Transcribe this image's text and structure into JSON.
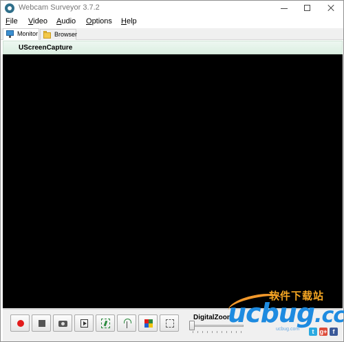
{
  "window": {
    "title": "Webcam Surveyor 3.7.2"
  },
  "menu": {
    "file": {
      "accel": "F",
      "rest": "ile"
    },
    "video": {
      "accel": "V",
      "rest": "ideo"
    },
    "audio": {
      "accel": "A",
      "rest": "udio"
    },
    "options": {
      "accel": "O",
      "rest": "ptions"
    },
    "help": {
      "accel": "H",
      "rest": "elp"
    }
  },
  "tabs": [
    {
      "label": "Monitor",
      "icon": "monitor-icon",
      "active": true
    },
    {
      "label": "Browser",
      "icon": "folder-icon",
      "active": false
    }
  ],
  "capture": {
    "title": "UScreenCapture",
    "background": "#000000"
  },
  "toolbar": {
    "buttons": [
      {
        "name": "record",
        "icon": "record-icon"
      },
      {
        "name": "stop",
        "icon": "stop-icon"
      },
      {
        "name": "snapshot",
        "icon": "camera-icon"
      },
      {
        "name": "playback",
        "icon": "play-icon"
      },
      {
        "name": "motion-detection",
        "icon": "motion-icon"
      },
      {
        "name": "broadcast",
        "icon": "broadcast-icon"
      },
      {
        "name": "color-settings",
        "icon": "color-icon"
      },
      {
        "name": "full-screen",
        "icon": "fullscreen-icon"
      }
    ],
    "zoom_label": "DigitalZoom",
    "zoom_level": 0
  },
  "watermark": {
    "top_text": "软件下载站",
    "logo_main": "ucbug",
    "logo_suffix": ".cc",
    "url": "ucbug.com",
    "social": [
      "t",
      "g+",
      "f"
    ]
  },
  "colors": {
    "accent": "#1e8be0",
    "record": "#e21b1b",
    "header_bg": "#dcefe2"
  }
}
